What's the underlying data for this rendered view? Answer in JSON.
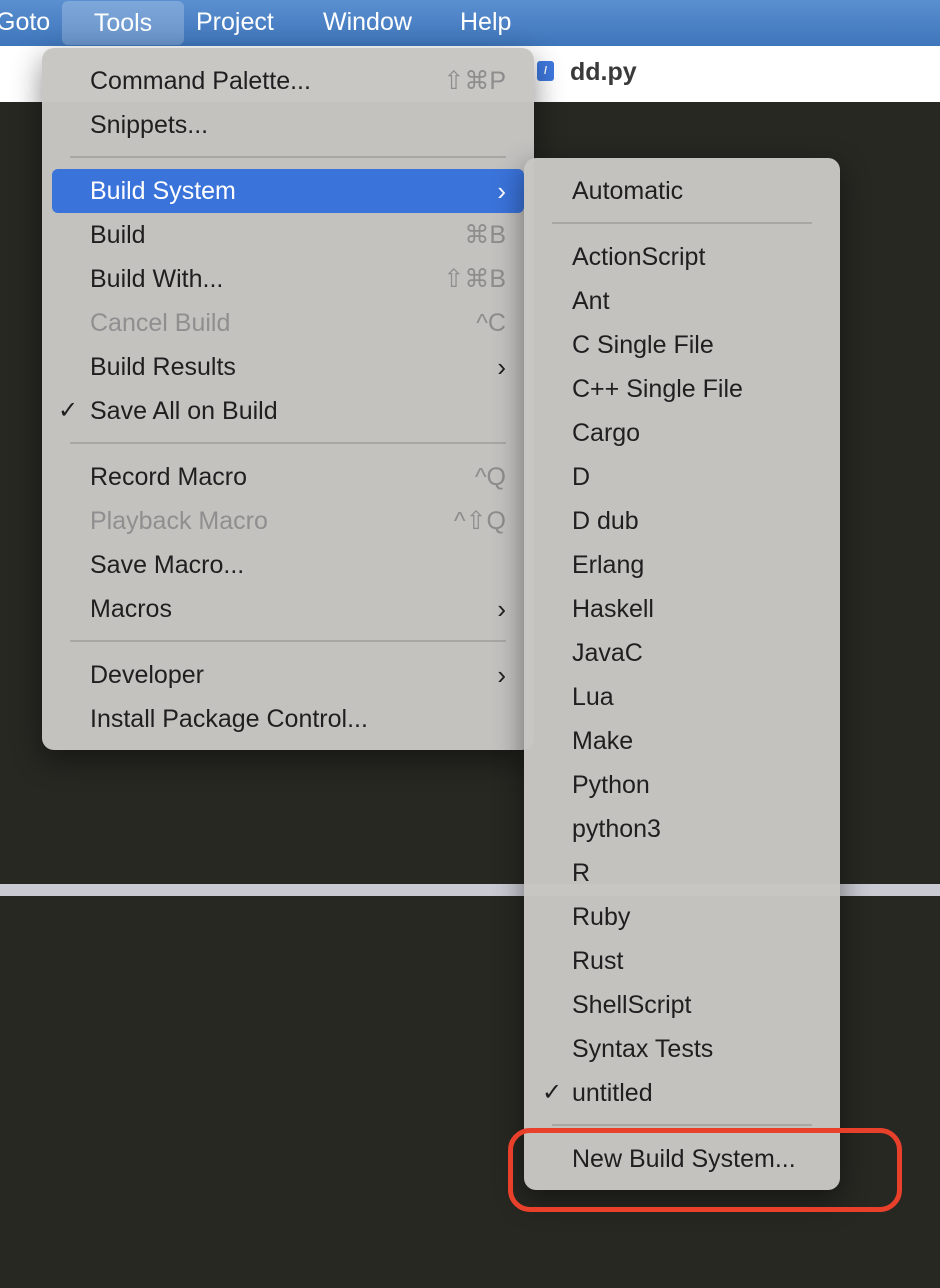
{
  "menubar": {
    "items": [
      "Goto",
      "Tools",
      "Project",
      "Window",
      "Help"
    ]
  },
  "tab": {
    "title": "dd.py"
  },
  "tools_menu": {
    "items": [
      {
        "label": "Command Palette...",
        "shortcut": "⇧⌘P"
      },
      {
        "label": "Snippets..."
      },
      {
        "label": "Build System",
        "submenu": true,
        "highlighted": true
      },
      {
        "label": "Build",
        "shortcut": "⌘B"
      },
      {
        "label": "Build With...",
        "shortcut": "⇧⌘B"
      },
      {
        "label": "Cancel Build",
        "shortcut": "^C",
        "disabled": true
      },
      {
        "label": "Build Results",
        "submenu": true
      },
      {
        "label": "Save All on Build",
        "checked": true
      },
      {
        "label": "Record Macro",
        "shortcut": "^Q"
      },
      {
        "label": "Playback Macro",
        "shortcut": "^⇧Q",
        "disabled": true
      },
      {
        "label": "Save Macro..."
      },
      {
        "label": "Macros",
        "submenu": true
      },
      {
        "label": "Developer",
        "submenu": true
      },
      {
        "label": "Install Package Control..."
      }
    ]
  },
  "build_menu": {
    "automatic": "Automatic",
    "items": [
      "ActionScript",
      "Ant",
      "C Single File",
      "C++ Single File",
      "Cargo",
      "D",
      "D dub",
      "Erlang",
      "Haskell",
      "JavaC",
      "Lua",
      "Make",
      "Python",
      "python3",
      "R",
      "Ruby",
      "Rust",
      "ShellScript",
      "Syntax Tests",
      "untitled"
    ],
    "checked_item": "untitled",
    "new_build_system": "New Build System..."
  },
  "colors": {
    "menubar": "#4a82c6",
    "highlight": "#3a73da",
    "editor_bg": "#272822",
    "annotation": "#e9402c"
  }
}
